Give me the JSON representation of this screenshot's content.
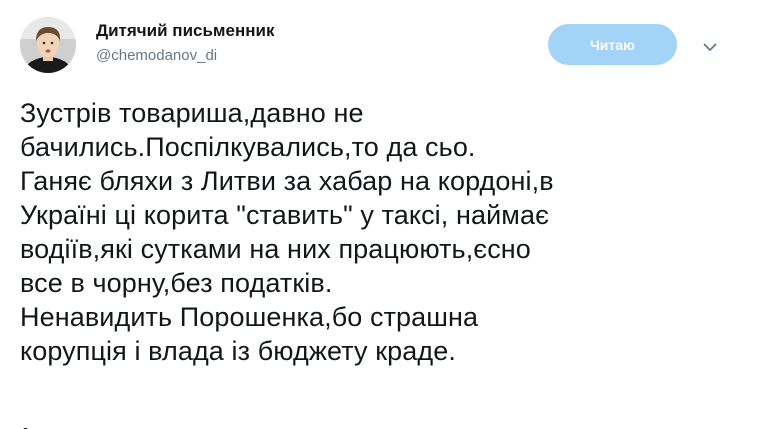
{
  "author": {
    "display_name": "Дитячий письменник",
    "handle": "@chemodanov_di",
    "avatar_icon": "user-avatar-photo"
  },
  "actions": {
    "follow_label": "Читаю",
    "follow_color": "#a3d3f6",
    "more_icon": "chevron-down-icon"
  },
  "tweet": {
    "lines": [
      "Зустрів товариша,давно не",
      "бачились.Поспілкувались,то да сьо.",
      "Ганяє бляхи з Литви за хабар на кордоні,в",
      "Україні ці корита \"ставить\" у таксі, наймає",
      "водіїв,які сутками на них працюють,єсно",
      "все в чорну,без податків.",
      "Ненавидить Порошенка,бо страшна",
      "корупція і влада із бюджету краде."
    ]
  }
}
